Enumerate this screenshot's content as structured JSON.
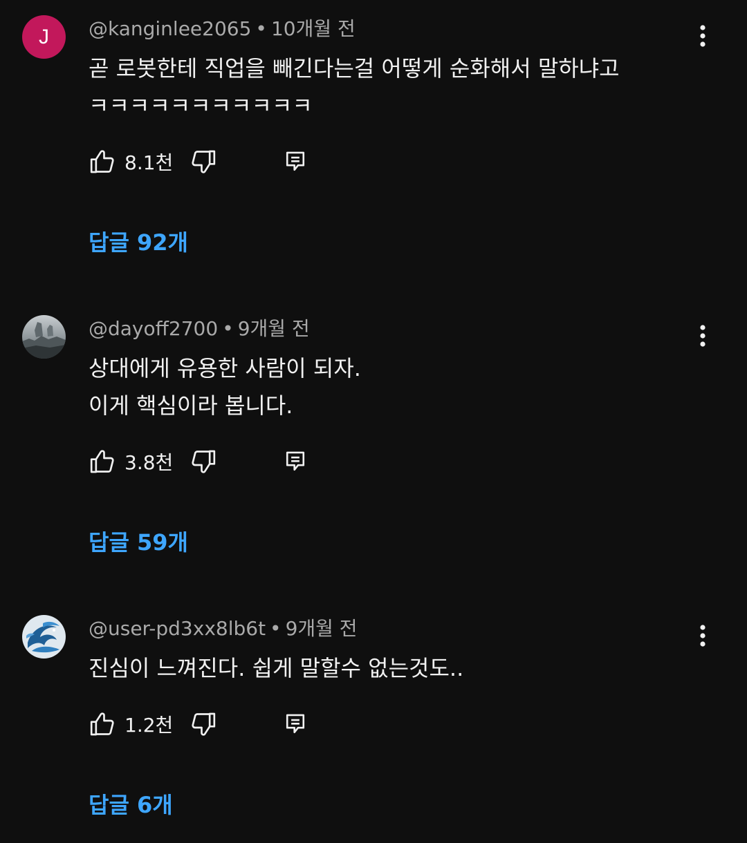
{
  "comments": [
    {
      "avatar": {
        "type": "letter",
        "letter": "J",
        "color": "#c2185b"
      },
      "author": "@kanginlee2065",
      "time": "10개월 전",
      "lines": [
        "곧 로봇한테 직업을 빼긴다는걸 어떻게 순화해서 말하냐고",
        "ㅋㅋㅋㅋㅋㅋㅋㅋㅋㅋㅋ"
      ],
      "likes": "8.1천",
      "replies": "답글 92개"
    },
    {
      "avatar": {
        "type": "photo",
        "description_icon": "landscape-avatar-icon"
      },
      "author": "@dayoff2700",
      "time": "9개월 전",
      "lines": [
        "상대에게 유용한 사람이 되자.",
        "이게 핵심이라 봅니다."
      ],
      "likes": "3.8천",
      "replies": "답글 59개"
    },
    {
      "avatar": {
        "type": "photo",
        "description_icon": "dragon-avatar-icon"
      },
      "author": "@user-pd3xx8lb6t",
      "time": "9개월 전",
      "lines": [
        "진심이 느껴진다. 쉽게 말할수 없는것도.."
      ],
      "likes": "1.2천",
      "replies": "답글 6개"
    }
  ],
  "separator": "•",
  "icons": {
    "like": "thumbs-up-icon",
    "dislike": "thumbs-down-icon",
    "reply": "reply-icon",
    "more": "more-vert-icon"
  },
  "colors": {
    "background": "#0f0f0f",
    "meta": "#aaaaaa",
    "text": "#f1f1f1",
    "link": "#3ea6ff"
  }
}
